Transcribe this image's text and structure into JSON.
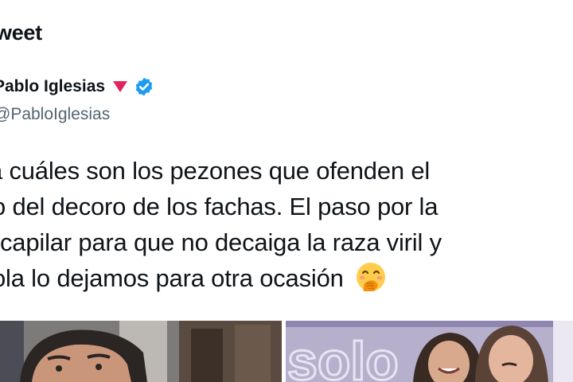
{
  "header": {
    "title": "weet"
  },
  "author": {
    "name": "Pablo Iglesias",
    "handle": "@PabloIglesias"
  },
  "tweet": {
    "lines": [
      "a cuáles son los pezones que ofenden el",
      "o del decoro de los fachas. El paso por la",
      "capilar para que no decaiga la raza viril y",
      "ola lo dejamos para otra ocasión"
    ],
    "emoji": "face-with-hand-over-mouth-icon"
  },
  "media": {
    "right_image_text": "solo"
  },
  "colors": {
    "text": "#0f1419",
    "secondary": "#536471",
    "verified": "#1d9bf0",
    "flag": "#e0245e"
  }
}
